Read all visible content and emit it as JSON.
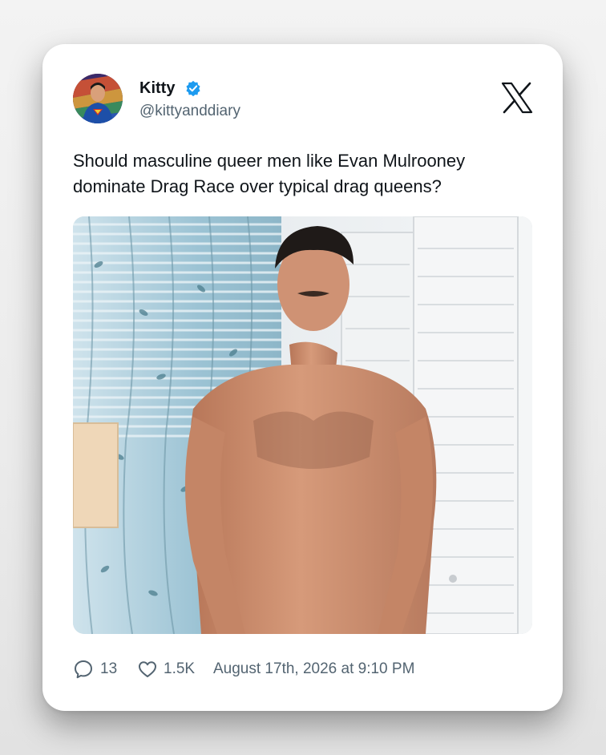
{
  "tweet": {
    "author_name": "Kitty",
    "author_handle": "@kittyanddiary",
    "verified": true,
    "text": "Should masculine queer men like Evan Mulrooney dominate Drag Race over typical drag queens?",
    "replies": "13",
    "likes": "1.5K",
    "timestamp": "August 17th, 2026 at 9:10 PM"
  },
  "icons": {
    "platform": "x-logo-icon",
    "verified": "verified-badge-icon",
    "reply": "comment-icon",
    "like": "heart-icon"
  },
  "colors": {
    "verified_blue": "#1d9bf0",
    "text_primary": "#0f1419",
    "text_secondary": "#536471"
  }
}
